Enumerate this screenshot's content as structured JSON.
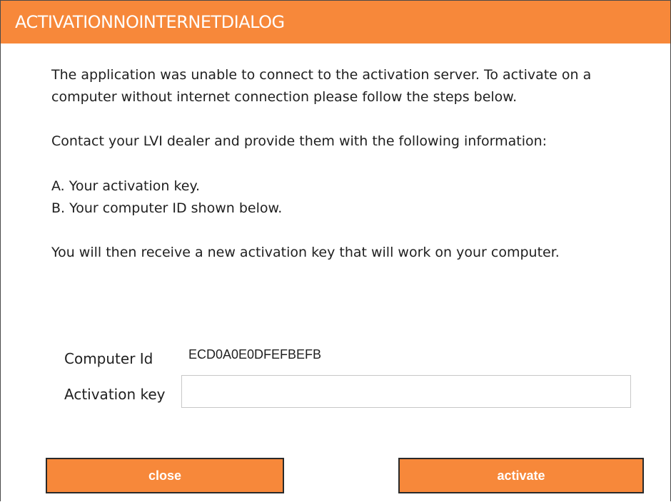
{
  "dialog": {
    "title": "ACTIVATIONNOINTERNETDIALOG",
    "accent_color": "#f7883a"
  },
  "message": {
    "line1": "The application was unable to connect to the activation server. To activate on a",
    "line2": "computer without internet connection please follow the steps below.",
    "line3": "Contact your LVI dealer and provide them with the following information:",
    "step_a": "A. Your activation key.",
    "step_b": "B. Your computer ID shown below.",
    "line4": "You will then receive a new activation key that will work on your computer."
  },
  "fields": {
    "computer_id_label": "Computer Id",
    "computer_id_value": "ECD0A0E0DFEFBEFB",
    "activation_key_label": "Activation key",
    "activation_key_value": ""
  },
  "buttons": {
    "close_label": "close",
    "activate_label": "activate"
  }
}
